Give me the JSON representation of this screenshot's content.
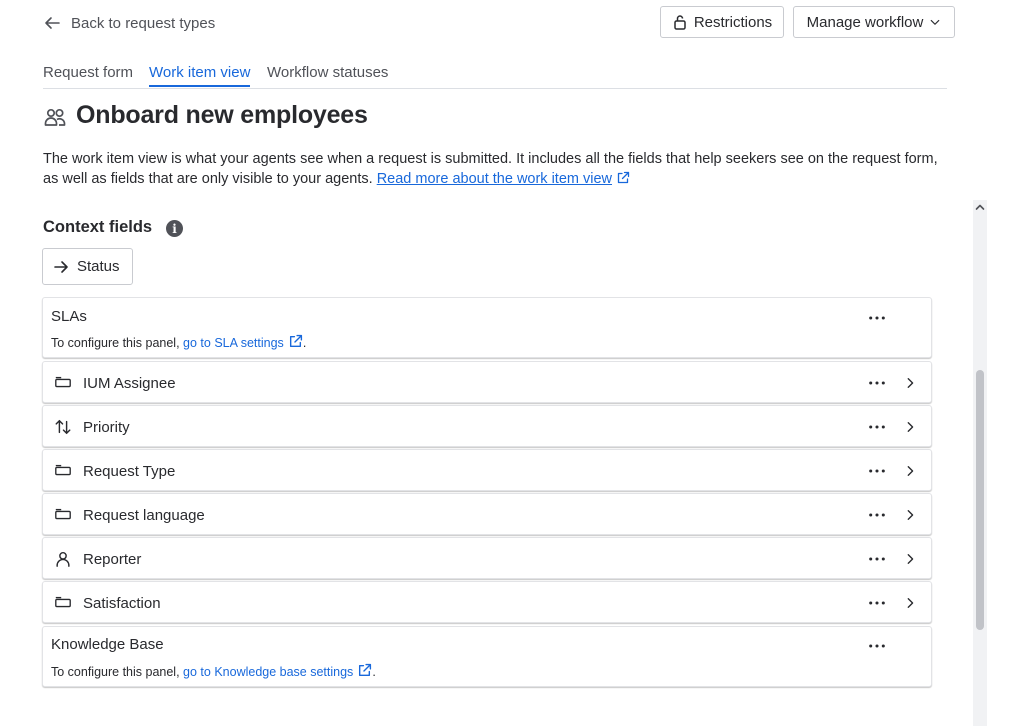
{
  "header": {
    "back_label": "Back to request types",
    "restrictions_label": "Restrictions",
    "manage_workflow_label": "Manage workflow"
  },
  "tabs": [
    {
      "label": "Request form",
      "active": false
    },
    {
      "label": "Work item view",
      "active": true
    },
    {
      "label": "Workflow statuses",
      "active": false
    }
  ],
  "page": {
    "title": "Onboard new employees",
    "description": "The work item view is what your agents see when a request is submitted. It includes all the fields that help seekers see on the request form, as well as fields that are only visible to your agents.",
    "read_more_link": "Read more about the work item view"
  },
  "context": {
    "title": "Context fields",
    "info_glyph": "i",
    "status_button": "Status"
  },
  "panels": {
    "slas": {
      "title": "SLAs",
      "note_prefix": "To configure this panel,",
      "link": "go to SLA settings",
      "suffix": "."
    },
    "kb": {
      "title": "Knowledge Base",
      "note_prefix": "To configure this panel,",
      "link": "go to Knowledge base settings",
      "suffix": "."
    }
  },
  "fields": [
    {
      "label": "IUM Assignee",
      "icon": "field-icon"
    },
    {
      "label": "Priority",
      "icon": "priority-icon"
    },
    {
      "label": "Request Type",
      "icon": "field-icon"
    },
    {
      "label": "Request language",
      "icon": "field-icon"
    },
    {
      "label": "Reporter",
      "icon": "person-icon"
    },
    {
      "label": "Satisfaction",
      "icon": "field-icon"
    }
  ],
  "colors": {
    "link": "#1868db",
    "text": "#292a2e",
    "subtle": "#505258",
    "border": "#c9cbd0"
  }
}
